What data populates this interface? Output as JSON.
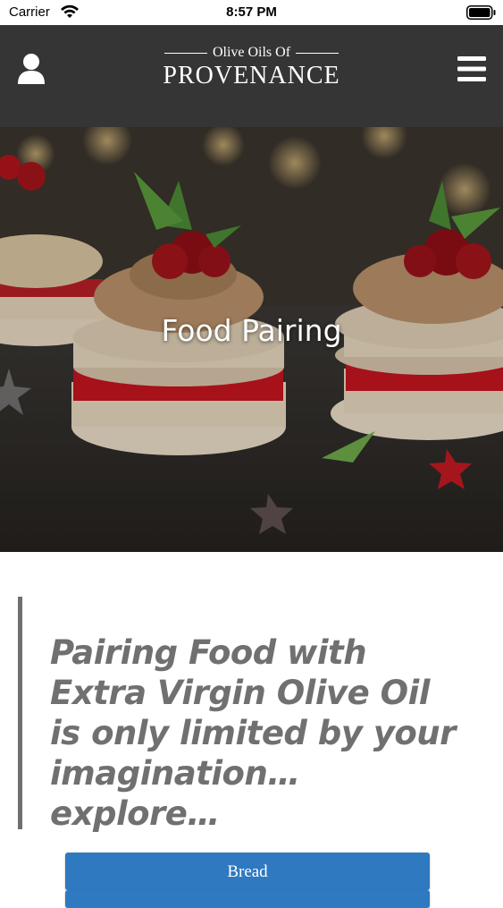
{
  "status_bar": {
    "carrier": "Carrier",
    "time": "8:57 PM"
  },
  "header": {
    "logo_top": "Olive Oils Of",
    "logo_main": "PROVENANCE",
    "background": "#353535"
  },
  "hero": {
    "title": "Food Pairing"
  },
  "quote": {
    "text": "Pairing Food with Extra Virgin Olive Oil is only limited by your imagination… explore…"
  },
  "categories": [
    {
      "label": "Bread"
    },
    {
      "label": ""
    }
  ],
  "colors": {
    "accent": "#2f79c1",
    "quote_text": "#707070",
    "quote_border": "#6f6f6f"
  },
  "icons": {
    "user": "user-icon",
    "menu": "menu-icon",
    "wifi": "wifi-icon",
    "battery": "battery-icon"
  }
}
